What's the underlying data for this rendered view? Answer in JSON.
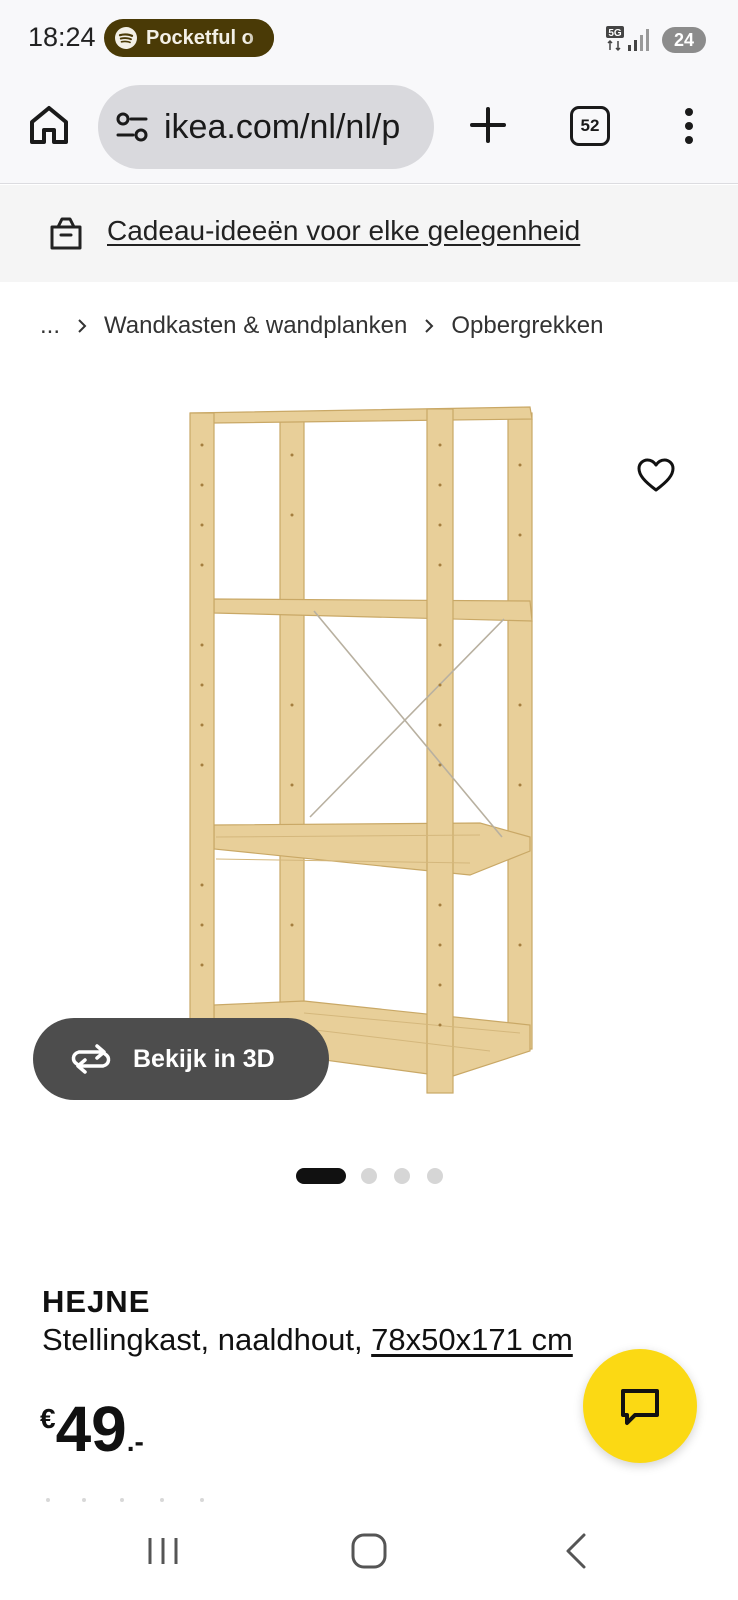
{
  "status_bar": {
    "time": "18:24",
    "media_app": "Pocketful o",
    "network": "5G",
    "battery": "24"
  },
  "browser": {
    "url": "ikea.com/nl/nl/p",
    "tab_count": "52"
  },
  "promo": {
    "text": "Cadeau-ideeën voor elke gelegenheid"
  },
  "breadcrumb": {
    "ellipsis": "...",
    "items": [
      "Wandkasten & wandplanken",
      "Opbergrekken"
    ]
  },
  "gallery": {
    "view_3d_label": "Bekijk in 3D",
    "image_count": 4,
    "active_index": 0
  },
  "product": {
    "name": "HEJNE",
    "description": "Stellingkast, naaldhout, ",
    "size": "78x50x171 cm",
    "price_currency": "€",
    "price_int": "49",
    "price_dec": ".-"
  },
  "colors": {
    "chat_button": "#fbd914",
    "wood": "#e8cf99",
    "view3d_bg": "#4d4d4d"
  },
  "icons": [
    "spotify-icon",
    "home-icon",
    "site-settings-icon",
    "plus-icon",
    "tabs-icon",
    "more-vert-icon",
    "gift-box-icon",
    "chevron-right-icon",
    "heart-icon",
    "rotate-3d-icon",
    "chat-icon",
    "recents-icon",
    "nav-home-icon",
    "back-icon"
  ]
}
